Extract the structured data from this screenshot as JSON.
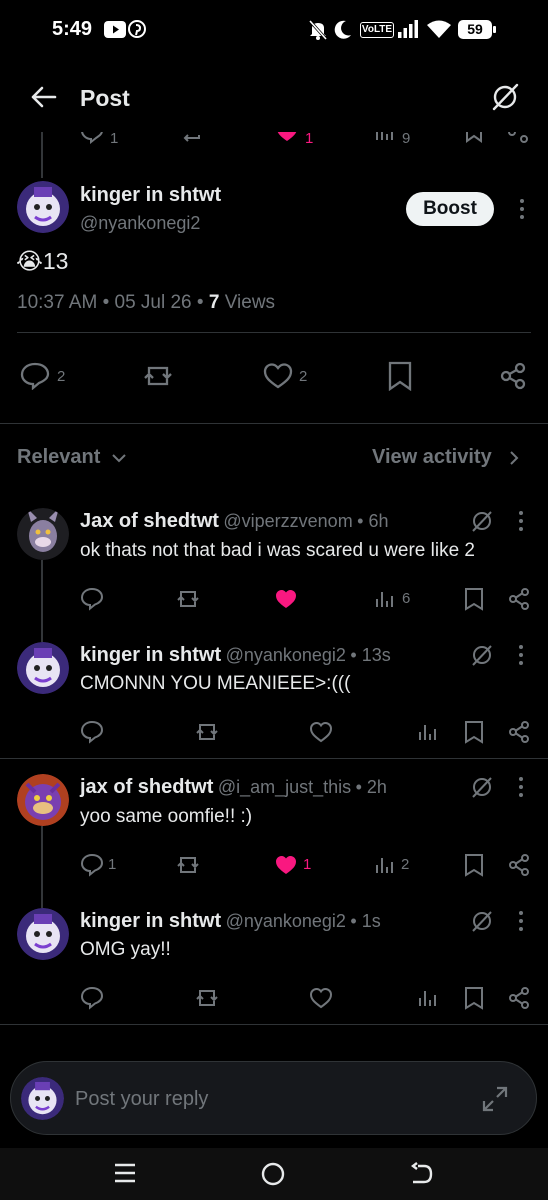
{
  "status_bar": {
    "time": "5:49",
    "volte": "VoLTE",
    "battery": "59"
  },
  "header": {
    "title": "Post"
  },
  "main_post": {
    "author_name": "kinger in shtwt",
    "author_handle": "@nyankonegi2",
    "boost_label": "Boost",
    "emoji": "😭",
    "text": "13",
    "time": "10:37 AM",
    "sep1": "•",
    "date": "05 Jul 26",
    "sep2": "•",
    "views_count": "7",
    "views_label": "Views",
    "replies": "2",
    "likes": "2"
  },
  "partial_prev_actions": {
    "replies": "1",
    "likes": "1",
    "views": "9"
  },
  "filter_bar": {
    "sort_label": "Relevant",
    "activity_label": "View activity"
  },
  "replies": [
    {
      "name": "Jax of shedtwt",
      "handle": "@viperzzvenom",
      "time": "• 6h",
      "text": "ok thats not that bad i was scared u were like 2",
      "reply_count": "",
      "like_count": "",
      "liked": true,
      "views": "6"
    },
    {
      "name": "kinger in shtwt",
      "handle": "@nyankonegi2",
      "time": "• 13s",
      "text": "CMONNN YOU MEANIEEE>:(((",
      "reply_count": "",
      "like_count": "",
      "liked": false,
      "views": ""
    },
    {
      "name": "jax of shedtwt",
      "handle": "@i_am_just_this",
      "time": "• 2h",
      "text": "yoo same oomfie!! :)",
      "reply_count": "1",
      "like_count": "1",
      "liked": true,
      "views": "2"
    },
    {
      "name": "kinger in shtwt",
      "handle": "@nyankonegi2",
      "time": "• 1s",
      "text": "OMG yay!!",
      "reply_count": "",
      "like_count": "",
      "liked": false,
      "views": ""
    }
  ],
  "composer": {
    "placeholder": "Post your reply"
  },
  "colors": {
    "background": "#000000",
    "text": "#e7e9ea",
    "muted": "#71767b",
    "like_pink": "#f91880",
    "divider": "#2f3336"
  }
}
